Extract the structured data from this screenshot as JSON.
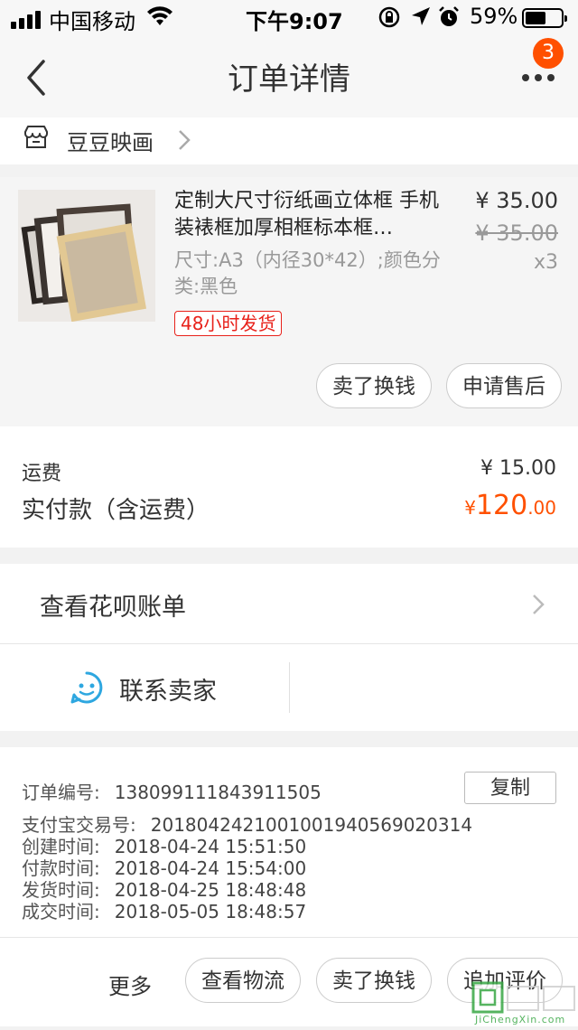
{
  "status_bar": {
    "carrier": "中国移动",
    "time": "下午9:07",
    "battery_percent": "59%",
    "battery_level": 0.59,
    "icons": [
      "signal-icon",
      "wifi-icon",
      "orientation-lock-icon",
      "location-icon",
      "alarm-icon",
      "battery-icon"
    ]
  },
  "nav": {
    "title": "订单详情",
    "badge": "3",
    "icons": [
      "back-icon",
      "more-icon"
    ]
  },
  "shop": {
    "name": "豆豆映画",
    "icons": [
      "store-icon",
      "chevron-right-icon"
    ]
  },
  "product": {
    "title": "定制大尺寸衍纸画立体框 手机装裱框加厚相框标本框…",
    "price": "¥ 35.00",
    "original_price": "¥ 35.00",
    "quantity": "x3",
    "sku": "尺寸:A3（内径30*42）;颜色分类:黑色",
    "shipping_tag": "48小时发货",
    "buttons": {
      "sell": "卖了换钱",
      "after_sale": "申请售后"
    }
  },
  "fees": {
    "freight_label": "运费",
    "freight_value": "¥ 15.00",
    "paid_label": "实付款（含运费）",
    "paid_symbol": "¥",
    "paid_int": "120",
    "paid_dec": ".00"
  },
  "huabei": {
    "label": "查看花呗账单"
  },
  "contact": {
    "label": "联系卖家",
    "icon": "chat-face-icon"
  },
  "order_info": {
    "order_no_label": "订单编号:",
    "order_no": "138099111843911505",
    "copy_label": "复制",
    "alipay_label": "支付宝交易号:",
    "alipay_no": "2018042421001001940569020314",
    "created_label": "创建时间:",
    "created": "2018-04-24 15:51:50",
    "paid_label": "付款时间:",
    "paid": "2018-04-24 15:54:00",
    "shipped_label": "发货时间:",
    "shipped": "2018-04-25 18:48:48",
    "completed_label": "成交时间:",
    "completed": "2018-05-05 18:48:57"
  },
  "bottom": {
    "more_label": "更多",
    "logistics": "查看物流",
    "sell": "卖了换钱",
    "review": "追加评价"
  },
  "watermark": {
    "text": "JiChengXin.com"
  },
  "colors": {
    "accent": "#ff5000",
    "tag_red": "#e8211a",
    "contact_icon": "#2ea7e0"
  }
}
